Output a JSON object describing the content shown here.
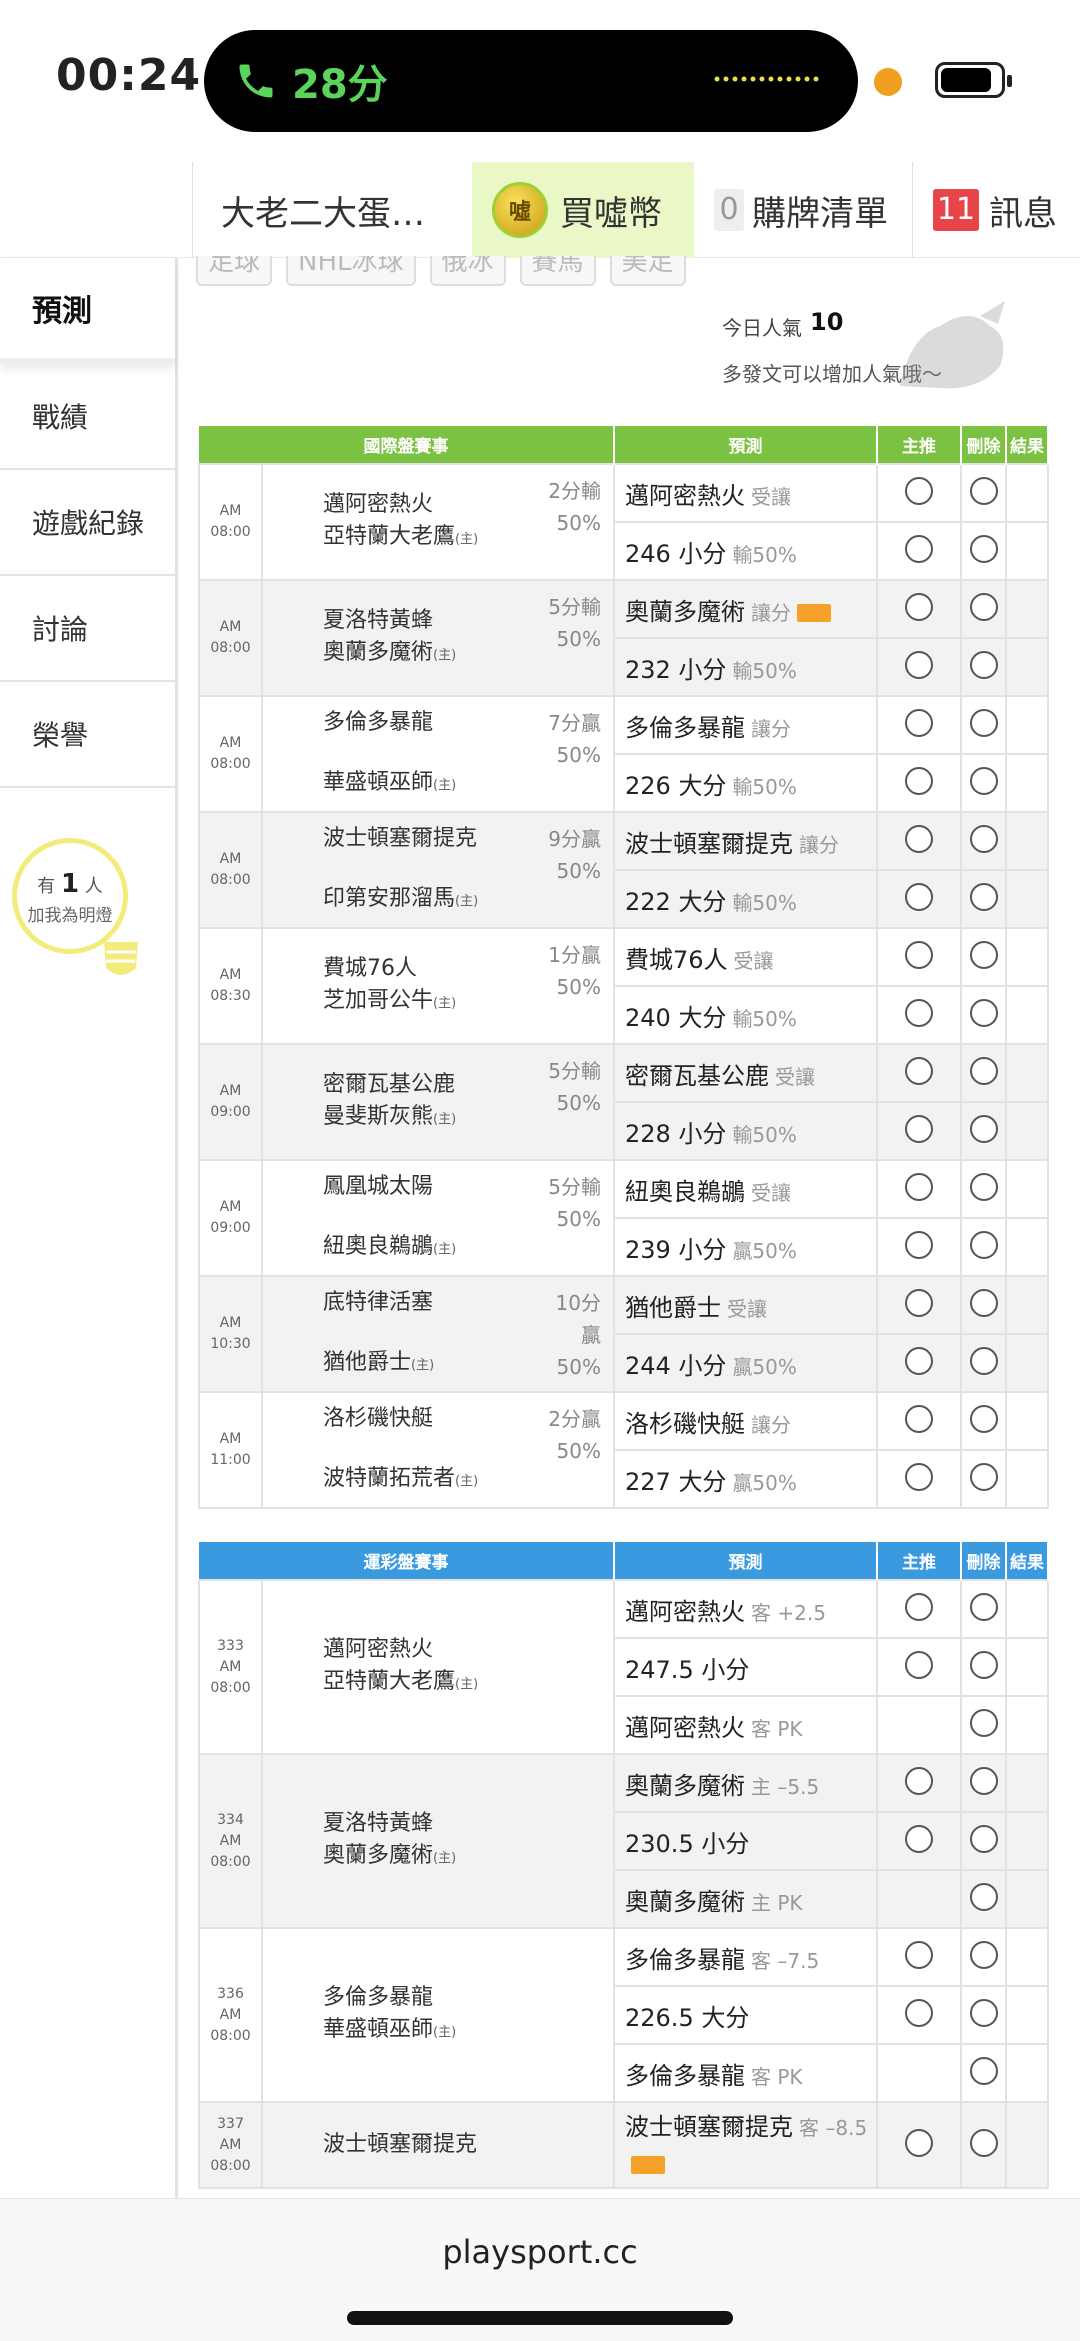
{
  "status": {
    "time": "00:24",
    "call_duration": "28分"
  },
  "topnav": {
    "user": "大老二大蛋…",
    "coin_icon_text": "噓",
    "coin_label": "買噓幣",
    "cart_count": "0",
    "cart_label": "購牌清單",
    "msg_count": "11",
    "msg_label": "訊息"
  },
  "subtags": [
    "足球",
    "NHL冰球",
    "俄冰",
    "賽馬",
    "美足"
  ],
  "sidebar": {
    "items": [
      {
        "label": "預測"
      },
      {
        "label": "戰績"
      },
      {
        "label": "遊戲紀錄"
      },
      {
        "label": "討論"
      },
      {
        "label": "榮譽"
      }
    ],
    "bulb": {
      "prefix": "有",
      "count": "1",
      "suffix": "人",
      "sub": "加我為明燈"
    }
  },
  "popularity": {
    "label": "今日人氣",
    "value": "10",
    "hint": "多發文可以增加人氣哦～"
  },
  "intl": {
    "headers": [
      "國際盤賽事",
      "預測",
      "主推",
      "刪除",
      "結果"
    ],
    "home_mark": "(主)",
    "games": [
      {
        "time": "AM 08:00",
        "away": "邁阿密熱火",
        "home": "亞特蘭大老鷹",
        "line": "2分輸",
        "pct": "50%",
        "picks": [
          {
            "main": "邁阿密熱火",
            "sub": "受讓"
          },
          {
            "main": "246 小分",
            "sub": "輸50%"
          }
        ]
      },
      {
        "time": "AM 08:00",
        "away": "夏洛特黃蜂",
        "home": "奧蘭多魔術",
        "line": "5分輸",
        "pct": "50%",
        "picks": [
          {
            "main": "奧蘭多魔術",
            "sub": "讓分",
            "tag": true
          },
          {
            "main": "232 小分",
            "sub": "輸50%"
          }
        ]
      },
      {
        "time": "AM 08:00",
        "away": "多倫多暴龍",
        "home": "華盛頓巫師",
        "line": "7分贏",
        "pct": "50%",
        "picks": [
          {
            "main": "多倫多暴龍",
            "sub": "讓分"
          },
          {
            "main": "226 大分",
            "sub": "輸50%"
          }
        ]
      },
      {
        "time": "AM 08:00",
        "away": "波士頓塞爾提克",
        "home": "印第安那溜馬",
        "line": "9分贏",
        "pct": "50%",
        "picks": [
          {
            "main": "波士頓塞爾提克",
            "sub": "讓分"
          },
          {
            "main": "222 大分",
            "sub": "輸50%"
          }
        ]
      },
      {
        "time": "AM 08:30",
        "away": "費城76人",
        "home": "芝加哥公牛",
        "line": "1分贏",
        "pct": "50%",
        "picks": [
          {
            "main": "費城76人",
            "sub": "受讓"
          },
          {
            "main": "240 大分",
            "sub": "輸50%"
          }
        ]
      },
      {
        "time": "AM 09:00",
        "away": "密爾瓦基公鹿",
        "home": "曼斐斯灰熊",
        "line": "5分輸",
        "pct": "50%",
        "picks": [
          {
            "main": "密爾瓦基公鹿",
            "sub": "受讓"
          },
          {
            "main": "228 小分",
            "sub": "輸50%"
          }
        ]
      },
      {
        "time": "AM 09:00",
        "away": "鳳凰城太陽",
        "home": "紐奧良鵜鶘",
        "line": "5分輸",
        "pct": "50%",
        "picks": [
          {
            "main": "紐奧良鵜鶘",
            "sub": "受讓"
          },
          {
            "main": "239 小分",
            "sub": "贏50%"
          }
        ]
      },
      {
        "time": "AM 10:30",
        "away": "底特律活塞",
        "home": "猶他爵士",
        "line": "10分贏",
        "pct": "50%",
        "picks": [
          {
            "main": "猶他爵士",
            "sub": "受讓"
          },
          {
            "main": "244 小分",
            "sub": "贏50%"
          }
        ]
      },
      {
        "time": "AM 11:00",
        "away": "洛杉磯快艇",
        "home": "波特蘭拓荒者",
        "line": "2分贏",
        "pct": "50%",
        "picks": [
          {
            "main": "洛杉磯快艇",
            "sub": "讓分"
          },
          {
            "main": "227 大分",
            "sub": "贏50%"
          }
        ]
      }
    ]
  },
  "lottery": {
    "headers": [
      "運彩盤賽事",
      "預測",
      "主推",
      "刪除",
      "結果"
    ],
    "games": [
      {
        "no": "333",
        "time": "AM 08:00",
        "away": "邁阿密熱火",
        "home": "亞特蘭大老鷹",
        "picks": [
          {
            "main": "邁阿密熱火",
            "sub": "客 +2.5"
          },
          {
            "main": "247.5 小分",
            "sub": ""
          },
          {
            "main": "邁阿密熱火",
            "sub": "客 PK"
          }
        ]
      },
      {
        "no": "334",
        "time": "AM 08:00",
        "away": "夏洛特黃蜂",
        "home": "奧蘭多魔術",
        "picks": [
          {
            "main": "奧蘭多魔術",
            "sub": "主 –5.5"
          },
          {
            "main": "230.5 小分",
            "sub": ""
          },
          {
            "main": "奧蘭多魔術",
            "sub": "主 PK"
          }
        ]
      },
      {
        "no": "336",
        "time": "AM 08:00",
        "away": "多倫多暴龍",
        "home": "華盛頓巫師",
        "picks": [
          {
            "main": "多倫多暴龍",
            "sub": "客 –7.5"
          },
          {
            "main": "226.5 大分",
            "sub": ""
          },
          {
            "main": "多倫多暴龍",
            "sub": "客 PK"
          }
        ]
      },
      {
        "no": "337",
        "time": "AM 08:00",
        "away": "波士頓塞爾提克",
        "home": "",
        "picks": [
          {
            "main": "波士頓塞爾提克",
            "sub": "客 –8.5",
            "tag": true
          }
        ]
      }
    ]
  },
  "urlbar": {
    "url": "playsport.cc"
  }
}
